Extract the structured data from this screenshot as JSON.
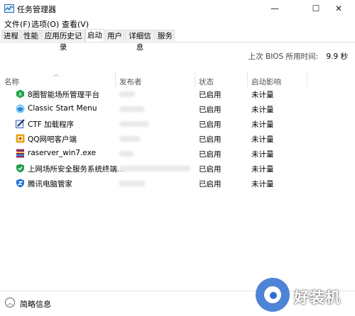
{
  "window": {
    "title": "任务管理器",
    "controls": {
      "minimize": "—",
      "maximize": "☐",
      "close": "✕"
    }
  },
  "menu": [
    "文件(F)",
    "选项(O)",
    "查看(V)"
  ],
  "tabs": [
    "进程",
    "性能",
    "应用历史记录",
    "启动",
    "用户",
    "详细信息",
    "服务"
  ],
  "active_tab": "启动",
  "bios": {
    "label": "上次 BIOS 所用时间:",
    "value": "9.9 秒"
  },
  "columns": [
    "名称",
    "发布者",
    "状态",
    "启动影响"
  ],
  "rows": [
    {
      "name": "8圈智能场所管理平台",
      "status": "已启用",
      "impact": "未计量",
      "icon": "green-hex-icon",
      "icon_color": "#1aa34a"
    },
    {
      "name": "Classic Start Menu",
      "status": "已启用",
      "impact": "未计量",
      "icon": "shell-orb-icon",
      "icon_color": "#2a8bd8"
    },
    {
      "name": "CTF 加载程序",
      "status": "已启用",
      "impact": "未计量",
      "icon": "pen-pad-icon",
      "icon_color": "#3b5fb0"
    },
    {
      "name": "QQ网吧客户端",
      "status": "已启用",
      "impact": "未计量",
      "icon": "qq-cube-icon",
      "icon_color": "#e8a317"
    },
    {
      "name": "raserver_win7.exe",
      "status": "已启用",
      "impact": "未计量",
      "icon": "rar-box-icon",
      "icon_color": "#8b2a6b"
    },
    {
      "name": "上网场所安全服务系统终端...",
      "status": "已启用",
      "impact": "未计量",
      "icon": "green-shield-icon",
      "icon_color": "#1f9d4c"
    },
    {
      "name": "腾讯电脑管家",
      "status": "已启用",
      "impact": "未计量",
      "icon": "blue-shield-icon",
      "icon_color": "#1e6fd8"
    }
  ],
  "footer": {
    "label": "简略信息"
  },
  "watermark": {
    "text": "好装机"
  }
}
